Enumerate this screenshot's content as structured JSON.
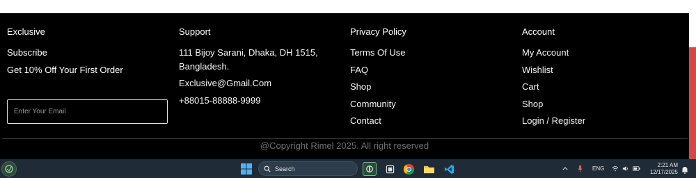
{
  "footer": {
    "exclusive": {
      "title": "Exclusive",
      "subscribe": "Subscribe",
      "offer": "Get 10% Off Your First Order",
      "email_placeholder": "Enter Your Email"
    },
    "support": {
      "title": "Support",
      "address_line1": "111 Bijoy Sarani, Dhaka, DH 1515,",
      "address_line2": "Bangladesh.",
      "email": "Exclusive@Gmail.Com",
      "phone": "+88015-88888-9999"
    },
    "privacy": {
      "title": "Privacy Policy",
      "links": [
        "Terms Of Use",
        "FAQ",
        "Shop",
        "Community",
        "Contact"
      ]
    },
    "account": {
      "title": "Account",
      "links": [
        "My Account",
        "Wishlist",
        "Cart",
        "Shop",
        "Login / Register"
      ]
    },
    "copyright": "@Copyright Rimel 2025. All right reserved"
  },
  "taskbar": {
    "search_label": "Search",
    "lang": "ENG",
    "time": "2:21 AM",
    "date": "12/17/2025",
    "icons": [
      "windows-start-icon",
      "search-icon",
      "app-icon",
      "notes-icon",
      "chrome-icon",
      "file-explorer-icon",
      "vscode-icon"
    ]
  },
  "colors": {
    "footer_bg": "#000000",
    "accent_red": "#db4444",
    "taskbar_bg": "#1f2c38"
  }
}
